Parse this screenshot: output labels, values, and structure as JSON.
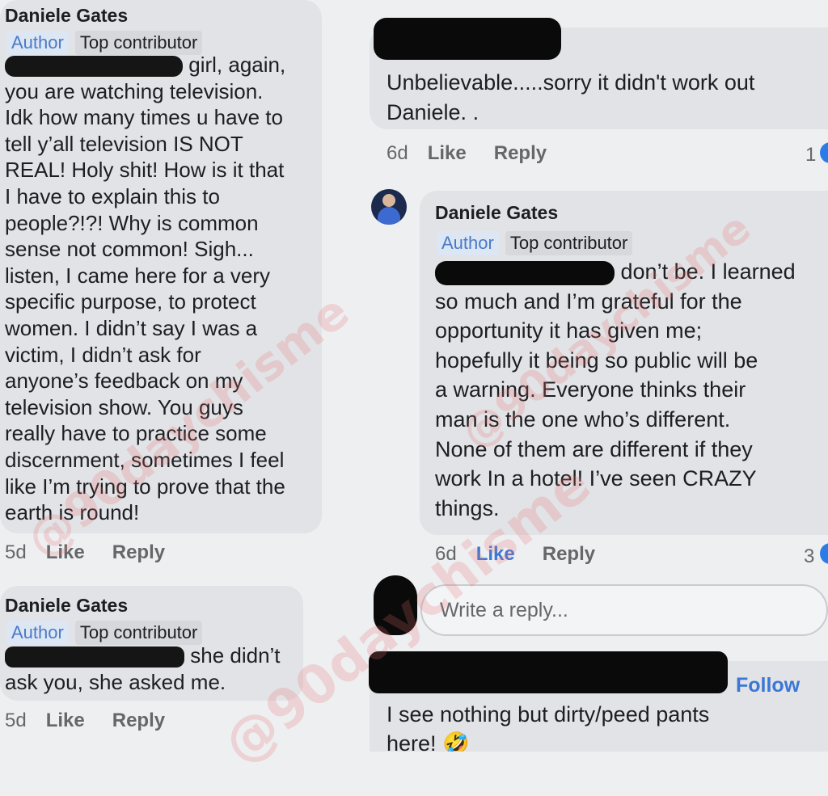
{
  "left_comments": [
    {
      "author": "Daniele Gates",
      "badge_author": "Author",
      "badge_top": "Top contributor",
      "mention_visible_suffix": "girl, again,",
      "body_lines": [
        "you are watching television.",
        "Idk how many times u have to",
        "tell y’all television IS NOT",
        "REAL! Holy shit! How is it that",
        "I have to explain this to",
        "people?!?! Why is common",
        "sense not common!  Sigh...",
        "listen, I came here for a very",
        "specific purpose, to protect",
        "women. I didn’t say I was a",
        "victim, I didn’t ask for",
        "anyone’s feedback on my",
        "television show. You guys",
        "really have to practice some",
        "discernment, sometimes I feel",
        "like I’m trying to prove that the",
        "earth is round!"
      ],
      "time": "5d",
      "like": "Like",
      "reply": "Reply"
    },
    {
      "author": "Daniele Gates",
      "badge_author": "Author",
      "badge_top": "Top contributor",
      "mention_visible_suffix": "she didn’t",
      "body_lines": [
        "ask you, she asked me."
      ],
      "time": "5d",
      "like": "Like",
      "reply": "Reply"
    }
  ],
  "right_comments": [
    {
      "body_lines": [
        "Unbelievable.....sorry it didn't work out",
        "Daniele. ."
      ],
      "time": "6d",
      "like": "Like",
      "reply": "Reply",
      "reaction_count": "1"
    },
    {
      "author": "Daniele Gates",
      "badge_author": "Author",
      "badge_top": "Top contributor",
      "mention_visible_suffix": "don’t be. I learned",
      "body_lines": [
        "so much and I’m grateful for the",
        "opportunity it has given me;",
        "hopefully it being so public will be",
        "a warning. Everyone thinks their",
        "man is the one who’s different.",
        "None of them are different if they",
        "work In a hotel! I’ve seen CRAZY",
        "things."
      ],
      "time": "6d",
      "like": "Like",
      "reply": "Reply",
      "reaction_count": "3"
    },
    {
      "follow": "Follow",
      "body_lines": [
        "I see nothing but dirty/peed pants",
        "here! 🤣"
      ]
    }
  ],
  "reply_box": {
    "placeholder": "Write a reply..."
  },
  "watermark": "@90daychisme",
  "colors": {
    "background": "#eeeff1",
    "bubble": "#e2e3e6",
    "accent": "#3b77d6",
    "watermark": "#e66e6e"
  },
  "icons": {
    "avatar": "profile-photo",
    "reaction": "reaction-icon"
  }
}
